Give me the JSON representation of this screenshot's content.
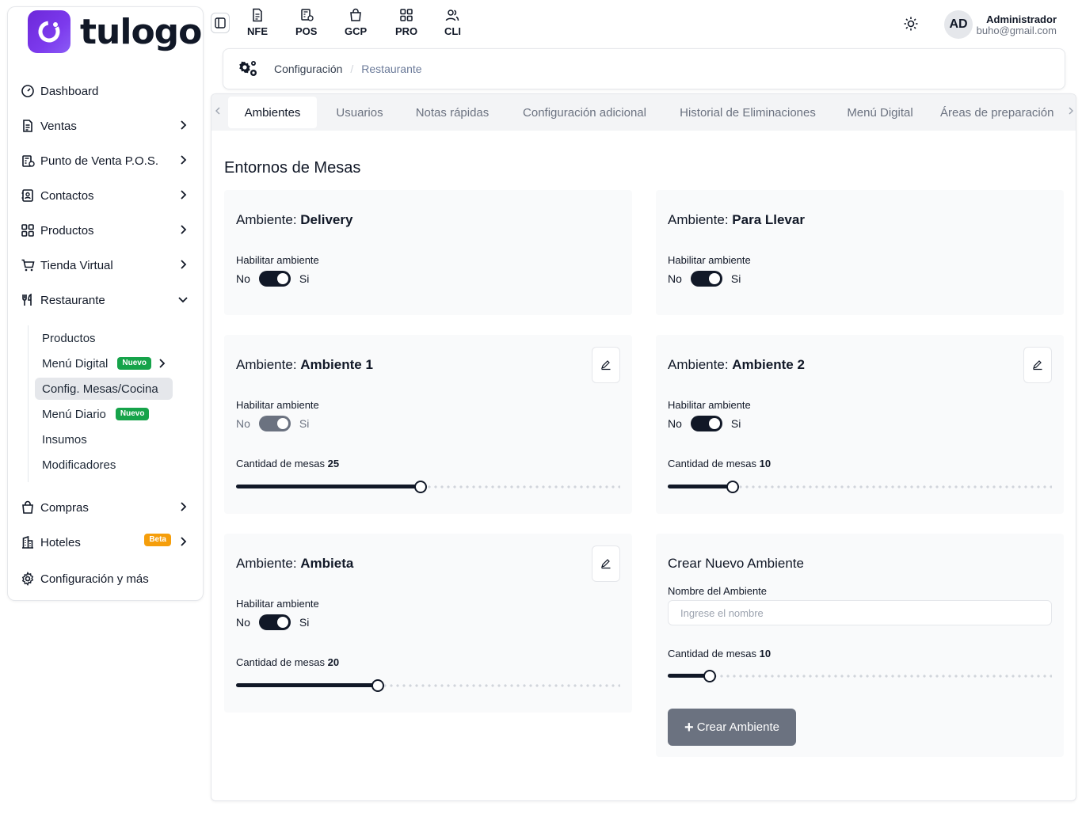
{
  "brand": {
    "name": "tulogo",
    "color": "#7c3aed"
  },
  "sidebar": {
    "items": [
      {
        "label": "Dashboard",
        "icon": "dashboard-icon"
      },
      {
        "label": "Ventas",
        "icon": "document-icon"
      },
      {
        "label": "Punto de Venta P.O.S.",
        "icon": "pos-icon"
      },
      {
        "label": "Contactos",
        "icon": "contacts-icon"
      },
      {
        "label": "Productos",
        "icon": "grid-icon"
      },
      {
        "label": "Tienda Virtual",
        "icon": "cart-icon"
      },
      {
        "label": "Restaurante",
        "icon": "utensils-icon"
      },
      {
        "label": "Compras",
        "icon": "bag-icon"
      },
      {
        "label": "Hoteles",
        "icon": "building-icon",
        "badge": "Beta"
      },
      {
        "label": "Configuración y más",
        "icon": "gear-icon"
      }
    ],
    "restaurante_sub": [
      {
        "label": "Productos"
      },
      {
        "label": "Menú Digital",
        "badge": "Nuevo"
      },
      {
        "label": "Config. Mesas/Cocina"
      },
      {
        "label": "Menú Diario",
        "badge": "Nuevo"
      },
      {
        "label": "Insumos"
      },
      {
        "label": "Modificadores"
      }
    ]
  },
  "topbar": {
    "items": [
      {
        "label": "NFE",
        "icon": "file-icon"
      },
      {
        "label": "POS",
        "icon": "pos-icon"
      },
      {
        "label": "GCP",
        "icon": "bag-icon"
      },
      {
        "label": "PRO",
        "icon": "grid-icon"
      },
      {
        "label": "CLI",
        "icon": "users-icon"
      }
    ],
    "user": {
      "initials": "AD",
      "name": "Administrador",
      "email": "buho@gmail.com"
    }
  },
  "breadcrumb": {
    "first": "Configuración",
    "second": "Restaurante"
  },
  "tabs": [
    "Ambientes",
    "Usuarios",
    "Notas rápidas",
    "Configuración adicional",
    "Historial de Eliminaciones",
    "Menú Digital",
    "Áreas de preparación"
  ],
  "section_title": "Entornos de Mesas",
  "labels": {
    "ambiente_prefix": "Ambiente:",
    "habilitar": "Habilitar ambiente",
    "no": "No",
    "si": "Si",
    "cantidad": "Cantidad de mesas"
  },
  "ambientes": [
    {
      "name": "Delivery",
      "enabled": true
    },
    {
      "name": "Para Llevar",
      "enabled": true
    },
    {
      "name": "Ambiente 1",
      "enabled": true,
      "mesas": "25",
      "fill": 0.48
    },
    {
      "name": "Ambiente 2",
      "enabled": true,
      "mesas": "10",
      "fill": 0.17
    },
    {
      "name": "Ambieta",
      "enabled": true,
      "mesas": "20",
      "fill": 0.37
    }
  ],
  "create": {
    "title": "Crear Nuevo Ambiente",
    "name_label": "Nombre del Ambiente",
    "placeholder": "Ingrese el nombre",
    "mesas": "10",
    "fill": 0.11,
    "button": "Crear Ambiente"
  }
}
